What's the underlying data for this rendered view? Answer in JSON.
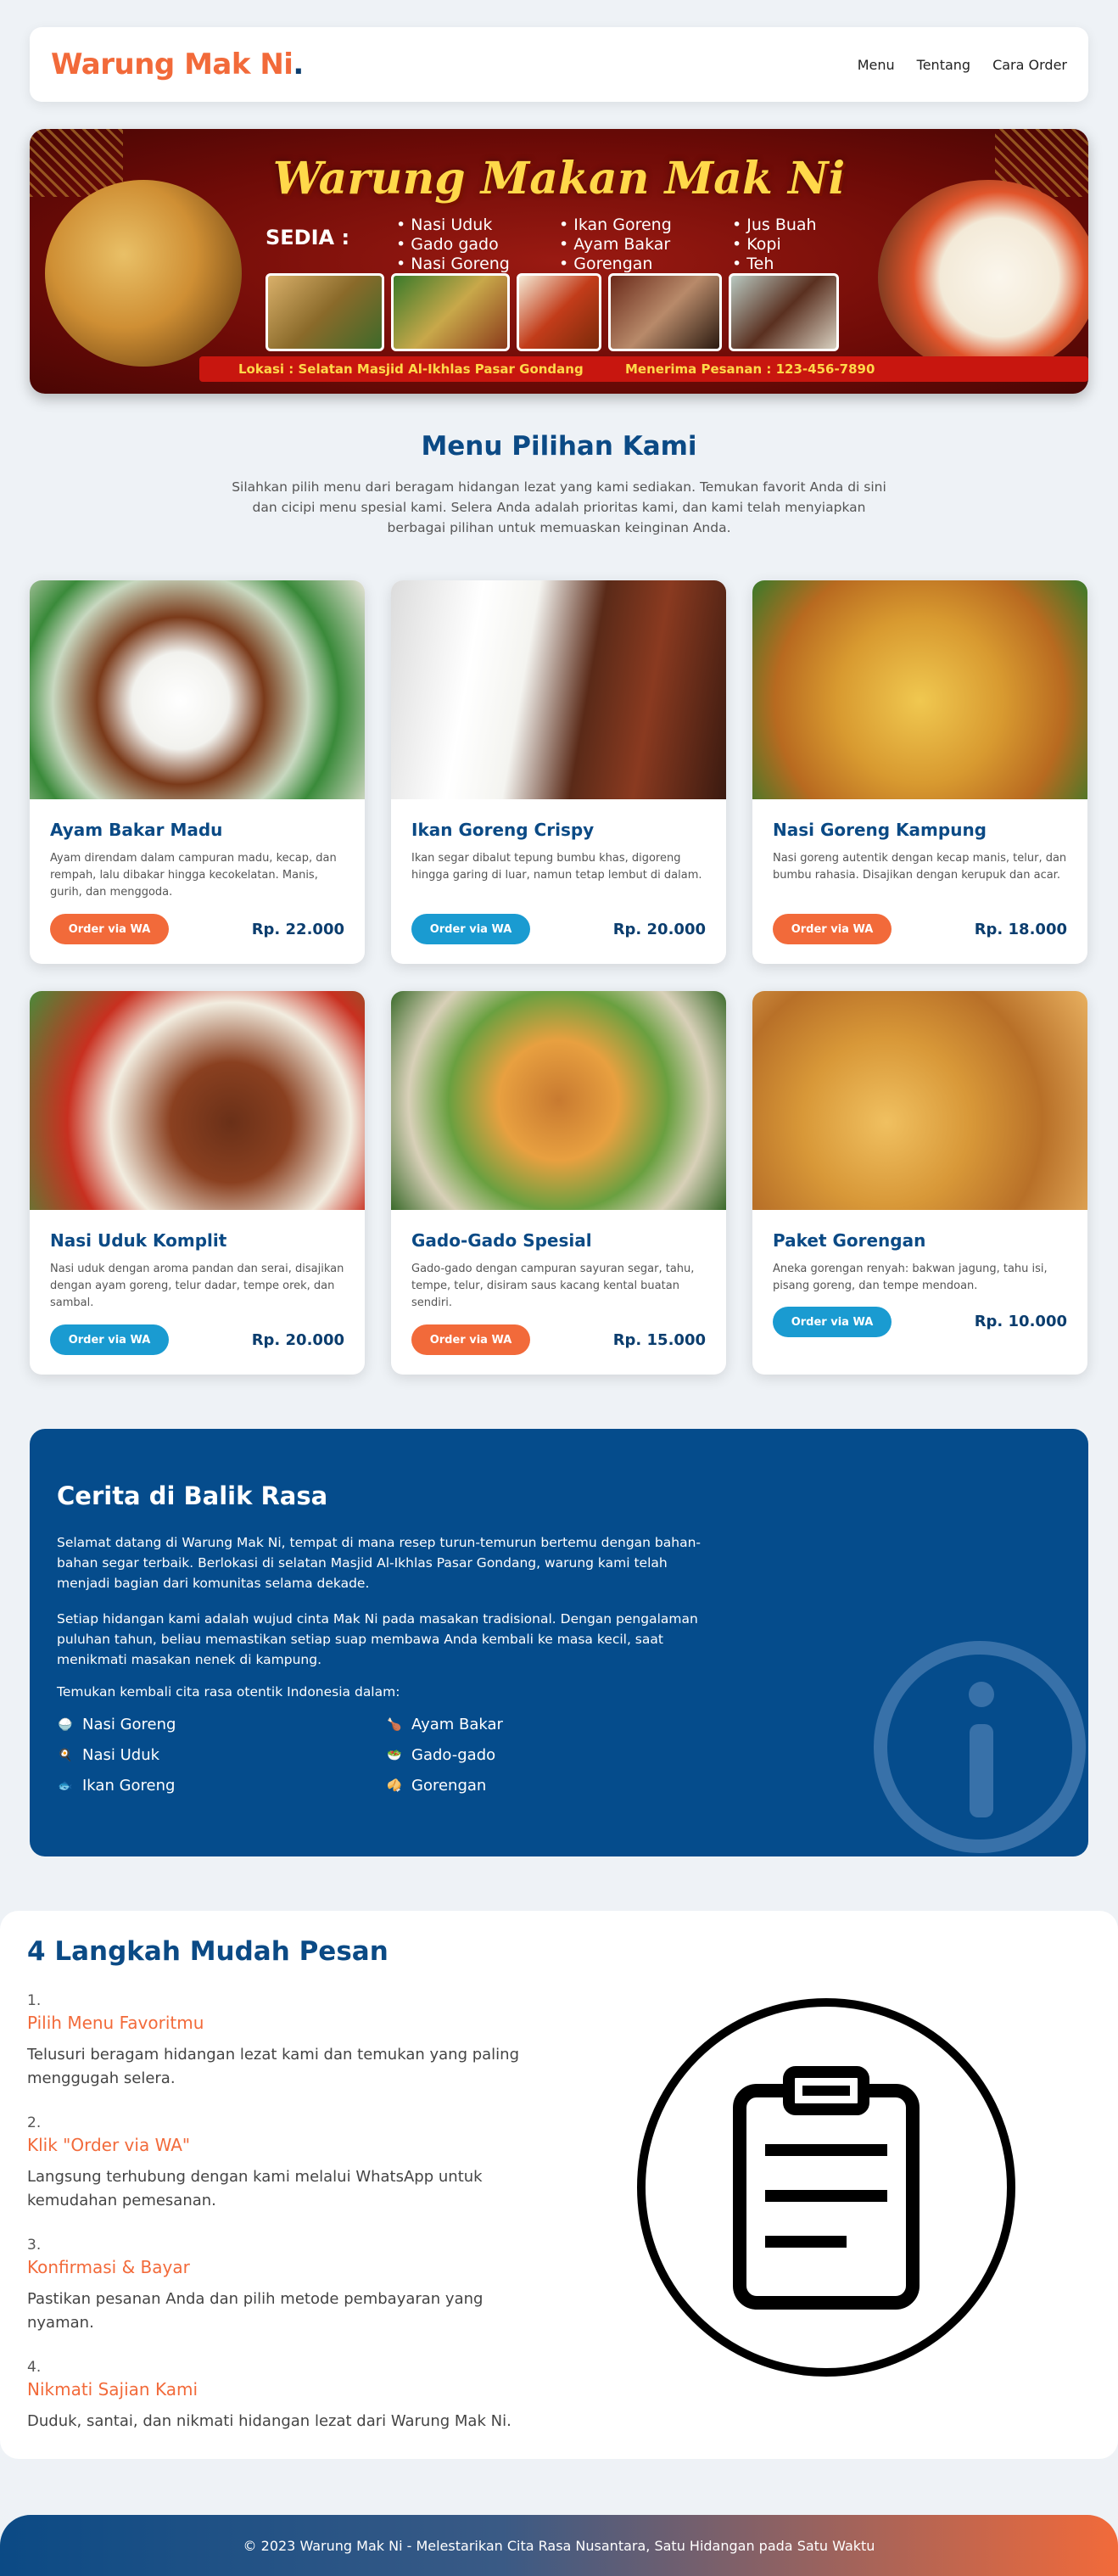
{
  "header": {
    "logo": "Warung Mak Ni",
    "logo_dot": ".",
    "nav": [
      "Menu",
      "Tentang",
      "Cara Order"
    ]
  },
  "banner": {
    "title": "Warung Makan Mak Ni",
    "sedia_label": "SEDIA :",
    "menu_col1": [
      "Nasi Uduk",
      "Gado gado",
      "Nasi Goreng"
    ],
    "menu_col2": [
      "Ikan Goreng",
      "Ayam Bakar",
      "Gorengan"
    ],
    "menu_col3": [
      "Jus Buah",
      "Kopi",
      "Teh"
    ],
    "location": "Lokasi : Selatan Masjid Al-Ikhlas Pasar Gondang",
    "order_phone": "Menerima Pesanan :  123-456-7890"
  },
  "menu_section": {
    "title": "Menu Pilihan Kami",
    "description": "Silahkan pilih menu dari beragam hidangan lezat yang kami sediakan. Temukan favorit Anda di sini dan cicipi menu spesial kami. Selera Anda adalah prioritas kami, dan kami telah menyiapkan berbagai pilihan untuk memuaskan keinginan Anda."
  },
  "cards": [
    {
      "name": "Ayam Bakar Madu",
      "desc": "Ayam direndam dalam campuran madu, kecap, dan rempah, lalu dibakar hingga kecokelatan. Manis, gurih, dan menggoda.",
      "button": "Order via WA",
      "price": "Rp. 22.000"
    },
    {
      "name": "Ikan Goreng Crispy",
      "desc": "Ikan segar dibalut tepung bumbu khas, digoreng hingga garing di luar, namun tetap lembut di dalam.",
      "button": "Order via WA",
      "price": "Rp. 20.000"
    },
    {
      "name": "Nasi Goreng Kampung",
      "desc": "Nasi goreng autentik dengan kecap manis, telur, dan bumbu rahasia. Disajikan dengan kerupuk dan acar.",
      "button": "Order via WA",
      "price": "Rp. 18.000"
    },
    {
      "name": "Nasi Uduk Komplit",
      "desc": "Nasi uduk dengan aroma pandan dan serai, disajikan dengan ayam goreng, telur dadar, tempe orek, dan sambal.",
      "button": "Order via WA",
      "price": "Rp. 20.000"
    },
    {
      "name": "Gado-Gado Spesial",
      "desc": "Gado-gado dengan campuran sayuran segar, tahu, tempe, telur, disiram saus kacang kental buatan sendiri.",
      "button": "Order via WA",
      "price": "Rp. 15.000"
    },
    {
      "name": "Paket Gorengan",
      "desc": "Aneka gorengan renyah: bakwan jagung, tahu isi, pisang goreng, dan tempe mendoan.",
      "button": "Order via WA",
      "price": "Rp. 10.000"
    }
  ],
  "story": {
    "title": "Cerita di Balik Rasa",
    "p1": "Selamat datang di Warung Mak Ni, tempat di mana resep turun-temurun bertemu dengan bahan-bahan segar terbaik. Berlokasi di selatan Masjid Al-Ikhlas Pasar Gondang, warung kami telah menjadi bagian dari komunitas selama dekade.",
    "p2": "Setiap hidangan kami adalah wujud cinta Mak Ni pada masakan tradisional. Dengan pengalaman puluhan tahun, beliau memastikan setiap suap membawa Anda kembali ke masa kecil, saat menikmati masakan nenek di kampung.",
    "p3": "Temukan kembali cita rasa otentik Indonesia dalam:",
    "dishes": [
      {
        "icon": "🍚",
        "label": "Nasi Goreng"
      },
      {
        "icon": "🍗",
        "label": "Ayam Bakar"
      },
      {
        "icon": "🍳",
        "label": "Nasi Uduk"
      },
      {
        "icon": "🥗",
        "label": "Gado-gado"
      },
      {
        "icon": "🐟",
        "label": "Ikan Goreng"
      },
      {
        "icon": "🥠",
        "label": "Gorengan"
      }
    ]
  },
  "steps": {
    "title": "4 Langkah Mudah Pesan",
    "items": [
      {
        "num": "1.",
        "name": "Pilih Menu Favoritmu",
        "desc": "Telusuri beragam hidangan lezat kami dan temukan yang paling menggugah selera."
      },
      {
        "num": "2.",
        "name": "Klik \"Order via WA\"",
        "desc": "Langsung terhubung dengan kami melalui WhatsApp untuk kemudahan pemesanan."
      },
      {
        "num": "3.",
        "name": "Konfirmasi & Bayar",
        "desc": "Pastikan pesanan Anda dan pilih metode pembayaran yang nyaman."
      },
      {
        "num": "4.",
        "name": "Nikmati Sajian Kami",
        "desc": "Duduk, santai, dan nikmati hidangan lezat dari Warung Mak Ni."
      }
    ]
  },
  "footer": {
    "text": "© 2023 Warung Mak Ni - Melestarikan Cita Rasa Nusantara, Satu Hidangan pada Satu Waktu"
  },
  "colors": {
    "brand_orange": "#f26a3a",
    "brand_blue": "#0b4a85",
    "wa_blue": "#1a9bd1",
    "story_bg": "#054c8c"
  }
}
